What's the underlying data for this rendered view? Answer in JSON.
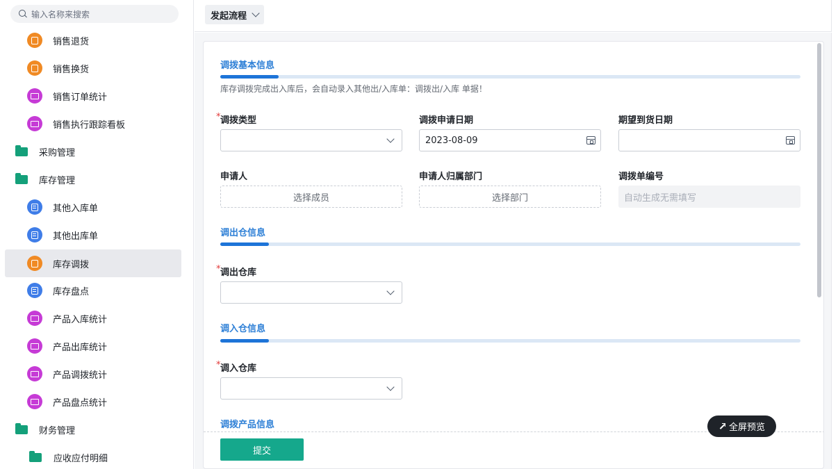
{
  "sidebar": {
    "search_placeholder": "输入名称来搜索",
    "items": [
      {
        "label": "销售退货",
        "icon": "orange-doc-icon"
      },
      {
        "label": "销售换货",
        "icon": "orange-doc-icon"
      },
      {
        "label": "销售订单统计",
        "icon": "purple-chart-icon"
      },
      {
        "label": "销售执行跟踪看板",
        "icon": "purple-chart-icon"
      },
      {
        "label": "采购管理",
        "icon": "folder-icon"
      },
      {
        "label": "库存管理",
        "icon": "folder-open-icon"
      },
      {
        "label": "其他入库单",
        "icon": "blue-form-icon"
      },
      {
        "label": "其他出库单",
        "icon": "blue-form-icon"
      },
      {
        "label": "库存调拨",
        "icon": "orange-doc-icon"
      },
      {
        "label": "库存盘点",
        "icon": "blue-form-icon"
      },
      {
        "label": "产品入库统计",
        "icon": "purple-chart-icon"
      },
      {
        "label": "产品出库统计",
        "icon": "purple-chart-icon"
      },
      {
        "label": "产品调拨统计",
        "icon": "purple-chart-icon"
      },
      {
        "label": "产品盘点统计",
        "icon": "purple-chart-icon"
      },
      {
        "label": "财务管理",
        "icon": "folder-open-icon"
      },
      {
        "label": "应收应付明细",
        "icon": "folder-icon"
      }
    ],
    "active_item": "库存调拨"
  },
  "topbar": {
    "flow_button": "发起流程"
  },
  "form": {
    "section_basic": "调拨基本信息",
    "hint": "库存调拨完成出入库后，会自动录入其他出/入库单：调拨出/入库 单据！",
    "transfer_type_label": "调拨类型",
    "apply_date_label": "调拨申请日期",
    "apply_date_value": "2023-08-09",
    "expected_date_label": "期望到货日期",
    "applicant_label": "申请人",
    "applicant_placeholder": "选择成员",
    "dept_label": "申请人归属部门",
    "dept_placeholder": "选择部门",
    "number_label": "调拨单编号",
    "number_placeholder": "自动生成无需填写",
    "section_out": "调出仓信息",
    "out_wh_label": "调出仓库",
    "section_in": "调入仓信息",
    "in_wh_label": "调入仓库",
    "section_products": "调拨产品信息",
    "required_mark": "*",
    "submit": "提交",
    "fullscreen": "全屏预览"
  },
  "colors": {
    "accent": "#2d7fd6",
    "submit": "#15a88c",
    "required": "#e23b3b"
  }
}
